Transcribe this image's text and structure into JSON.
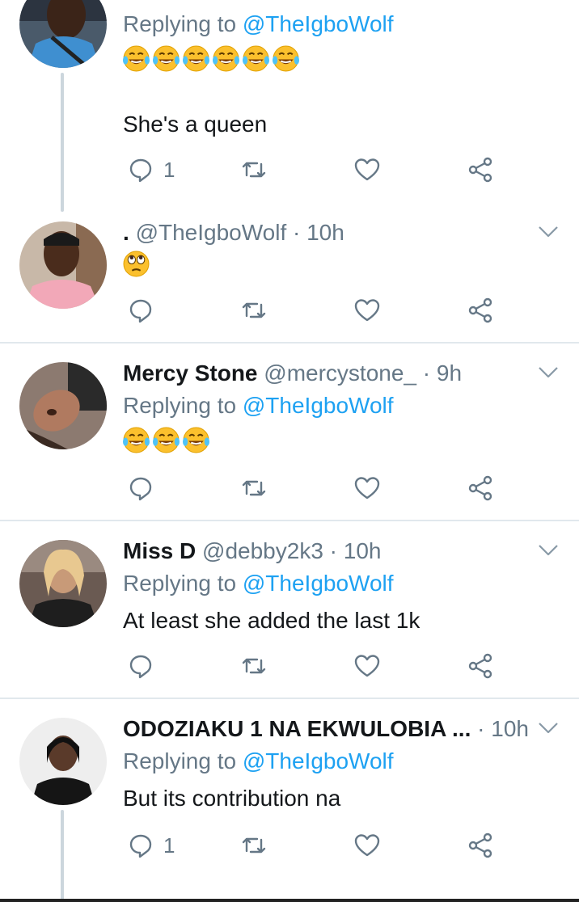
{
  "colors": {
    "link": "#1da1f2",
    "muted": "#657786",
    "text": "#14171a",
    "divider": "#e1e8ed",
    "thread_line": "#ccd6dd"
  },
  "icons": {
    "reply": "reply-icon",
    "retweet": "retweet-icon",
    "like": "heart-icon",
    "share": "share-icon",
    "more": "chevron-down-icon",
    "laughing": "tears-of-joy-emoji",
    "rolling_eyes": "rolling-eyes-emoji"
  },
  "tweets": [
    {
      "replying_prefix": "Replying to",
      "replying_handle": "@TheIgboWolf",
      "emoji": "😂😂😂😂😂😂",
      "text": "She's a queen",
      "reply_count": "1"
    },
    {
      "name": ".",
      "meta": "@TheIgboWolf · 10h",
      "emoji": "🙄"
    },
    {
      "name": "Mercy Stone",
      "meta": "@mercystone_ · 9h",
      "replying_prefix": "Replying to",
      "replying_handle": "@TheIgboWolf",
      "emoji": "😂😂😂"
    },
    {
      "name": "Miss D",
      "meta": "@debby2k3 · 10h",
      "replying_prefix": "Replying to",
      "replying_handle": "@TheIgboWolf",
      "text": "At least she added the last 1k"
    },
    {
      "name": "ODOZIAKU 1 NA EKWULOBIA ...",
      "meta": "· 10h",
      "replying_prefix": "Replying to",
      "replying_handle": "@TheIgboWolf",
      "text": "But its contribution na",
      "reply_count": "1"
    }
  ]
}
